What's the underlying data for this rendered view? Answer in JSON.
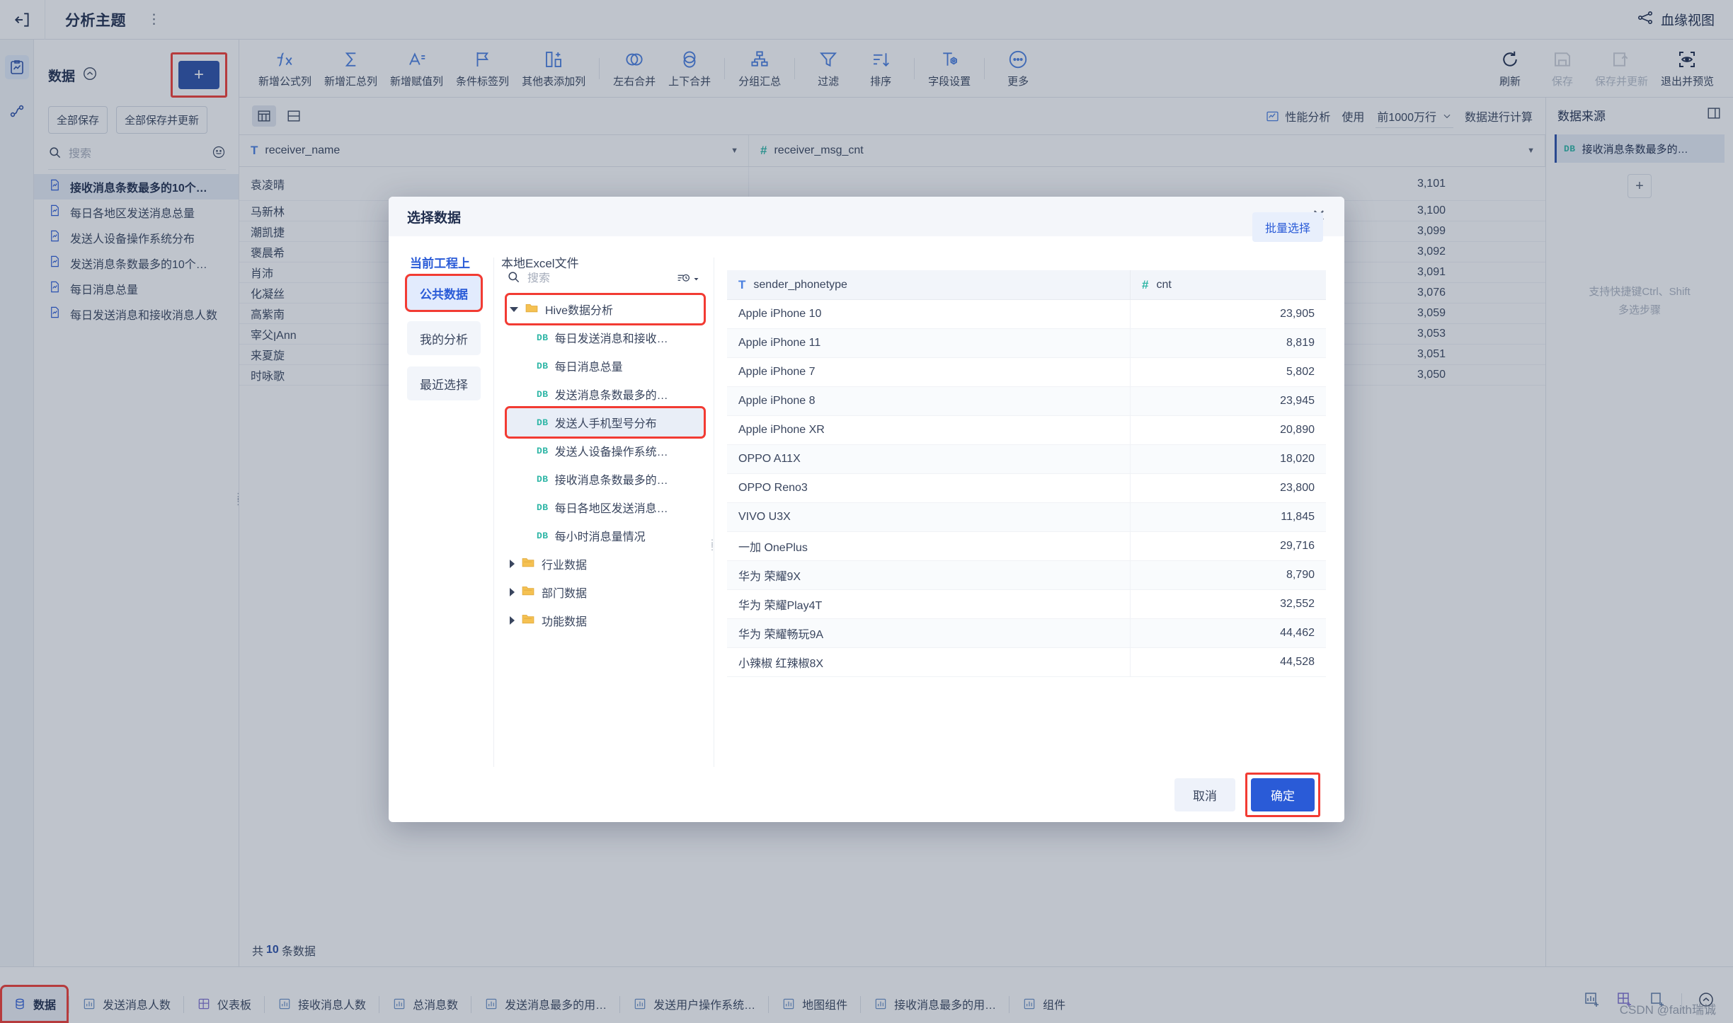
{
  "topbar": {
    "back_icon": "exit-left-icon",
    "title": "分析主题",
    "more_icon": "more-dots-icon",
    "lineage_label": "血缘视图",
    "lineage_icon": "lineage-icon"
  },
  "rail": {
    "items": [
      {
        "name": "analysis-board-icon",
        "label": ""
      },
      {
        "name": "data-flow-icon",
        "label": ""
      }
    ]
  },
  "left_panel": {
    "title": "数据",
    "collapse_icon": "collapse-chevron-icon",
    "add_label": "+",
    "save_all_label": "全部保存",
    "save_all_update_label": "全部保存并更新",
    "search_placeholder": "搜索",
    "search_value": "",
    "search_icon": "search-icon",
    "smile_icon": "smile-icon",
    "items": [
      {
        "label": "接收消息条数最多的10个…",
        "active": true
      },
      {
        "label": "每日各地区发送消息总量",
        "active": false
      },
      {
        "label": "发送人设备操作系统分布",
        "active": false
      },
      {
        "label": "发送消息条数最多的10个…",
        "active": false
      },
      {
        "label": "每日消息总量",
        "active": false
      },
      {
        "label": "每日发送消息和接收消息人数",
        "active": false
      }
    ]
  },
  "toolbar": {
    "tools": [
      {
        "label": "新增公式列",
        "icon": "fx-icon",
        "disabled": false
      },
      {
        "label": "新增汇总列",
        "icon": "sigma-icon",
        "disabled": false
      },
      {
        "label": "新增赋值列",
        "icon": "assign-column-icon",
        "disabled": false
      },
      {
        "label": "条件标签列",
        "icon": "flag-icon",
        "disabled": false
      },
      {
        "label": "其他表添加列",
        "icon": "add-column-icon",
        "disabled": false
      },
      {
        "label": "左右合并",
        "icon": "merge-horizontal-icon",
        "disabled": false
      },
      {
        "label": "上下合并",
        "icon": "merge-vertical-icon",
        "disabled": false
      },
      {
        "label": "分组汇总",
        "icon": "group-summary-icon",
        "disabled": false
      },
      {
        "label": "过滤",
        "icon": "filter-icon",
        "disabled": false
      },
      {
        "label": "排序",
        "icon": "sort-icon",
        "disabled": false
      },
      {
        "label": "字段设置",
        "icon": "field-settings-icon",
        "disabled": false
      },
      {
        "label": "更多",
        "icon": "more-circle-icon",
        "disabled": false
      }
    ],
    "right_tools": [
      {
        "label": "刷新",
        "icon": "refresh-icon",
        "disabled": false
      },
      {
        "label": "保存",
        "icon": "save-icon",
        "disabled": true
      },
      {
        "label": "保存并更新",
        "icon": "save-update-icon",
        "disabled": true
      },
      {
        "label": "退出并预览",
        "icon": "preview-icon",
        "disabled": false
      }
    ]
  },
  "main": {
    "view_table_icon": "table-view-icon",
    "view_card_icon": "card-view-icon",
    "perf_label": "性能分析",
    "perf_icon": "perf-icon",
    "use_label": "使用",
    "rows_value": "前1000万行",
    "rows_caret": "chevron-down-icon",
    "calc_label": "数据进行计算",
    "columns": [
      {
        "name": "receiver_name",
        "type_icon": "T"
      },
      {
        "name": "receiver_msg_cnt",
        "type_icon": "#"
      }
    ],
    "rows": [
      {
        "name": "袁凌晴",
        "value": "3,101"
      },
      {
        "name": "马新林",
        "value": "3,100"
      },
      {
        "name": "潮凯捷",
        "value": "3,099"
      },
      {
        "name": "褒晨希",
        "value": "3,092"
      },
      {
        "name": "肖沛",
        "value": "3,091"
      },
      {
        "name": "化凝丝",
        "value": "3,076"
      },
      {
        "name": "高紫南",
        "value": "3,059"
      },
      {
        "name": "宰父ןAnn",
        "value": "3,053"
      },
      {
        "name": "来夏旋",
        "value": "3,051"
      },
      {
        "name": "时咏歌",
        "value": "3,050"
      }
    ],
    "footer_prefix": "共",
    "footer_count": "10",
    "footer_suffix": "条数据"
  },
  "right_panel": {
    "title": "数据来源",
    "head_icon": "panel-collapse-icon",
    "items": [
      {
        "tag": "DB",
        "label": "接收消息条数最多的…"
      }
    ],
    "add_label": "+",
    "hint_line1": "支持快捷键Ctrl、Shift",
    "hint_line2": "多选步骤"
  },
  "modal": {
    "title": "选择数据",
    "close_icon": "close-icon",
    "tabs": [
      {
        "label": "当前工程上",
        "active": true
      },
      {
        "label": "本地Excel文件",
        "active": false
      }
    ],
    "batch_label": "批量选择",
    "side_items": [
      {
        "label": "公共数据",
        "active": true,
        "highlight": true
      },
      {
        "label": "我的分析",
        "active": false,
        "highlight": false
      },
      {
        "label": "最近选择",
        "active": false,
        "highlight": false
      }
    ],
    "search_placeholder": "搜索",
    "search_value": "",
    "search_icon": "search-icon",
    "history_icon": "history-filter-icon",
    "tree": [
      {
        "label": "Hive数据分析",
        "kind": "folder",
        "expanded": true,
        "indent": 0,
        "highlight": true
      },
      {
        "label": "每日发送消息和接收…",
        "kind": "db",
        "indent": 1,
        "selected": false
      },
      {
        "label": "每日消息总量",
        "kind": "db",
        "indent": 1,
        "selected": false
      },
      {
        "label": "发送消息条数最多的…",
        "kind": "db",
        "indent": 1,
        "selected": false
      },
      {
        "label": "发送人手机型号分布",
        "kind": "db",
        "indent": 1,
        "selected": true,
        "highlight": true
      },
      {
        "label": "发送人设备操作系统…",
        "kind": "db",
        "indent": 1,
        "selected": false
      },
      {
        "label": "接收消息条数最多的…",
        "kind": "db",
        "indent": 1,
        "selected": false
      },
      {
        "label": "每日各地区发送消息…",
        "kind": "db",
        "indent": 1,
        "selected": false
      },
      {
        "label": "每小时消息量情况",
        "kind": "db",
        "indent": 1,
        "selected": false
      },
      {
        "label": "行业数据",
        "kind": "folder",
        "expanded": false,
        "indent": 0
      },
      {
        "label": "部门数据",
        "kind": "folder",
        "expanded": false,
        "indent": 0
      },
      {
        "label": "功能数据",
        "kind": "folder",
        "expanded": false,
        "indent": 0
      }
    ],
    "table": {
      "columns": [
        {
          "name": "sender_phonetype",
          "type_icon": "T"
        },
        {
          "name": "cnt",
          "type_icon": "#"
        }
      ],
      "rows": [
        {
          "phone": "Apple iPhone 10",
          "cnt": "23,905"
        },
        {
          "phone": "Apple iPhone 11",
          "cnt": "8,819"
        },
        {
          "phone": "Apple iPhone 7",
          "cnt": "5,802"
        },
        {
          "phone": "Apple iPhone 8",
          "cnt": "23,945"
        },
        {
          "phone": "Apple iPhone XR",
          "cnt": "20,890"
        },
        {
          "phone": "OPPO A11X",
          "cnt": "18,020"
        },
        {
          "phone": "OPPO Reno3",
          "cnt": "23,800"
        },
        {
          "phone": "VIVO U3X",
          "cnt": "11,845"
        },
        {
          "phone": "一加 OnePlus",
          "cnt": "29,716"
        },
        {
          "phone": "华为 荣耀9X",
          "cnt": "8,790"
        },
        {
          "phone": "华为 荣耀Play4T",
          "cnt": "32,552"
        },
        {
          "phone": "华为 荣耀畅玩9A",
          "cnt": "44,462"
        },
        {
          "phone": "小辣椒 红辣椒8X",
          "cnt": "44,528"
        }
      ]
    },
    "cancel_label": "取消",
    "ok_label": "确定"
  },
  "bottom_tabs": [
    {
      "label": "数据",
      "icon": "database-icon",
      "active": true,
      "highlight": true
    },
    {
      "label": "发送消息人数",
      "icon": "chart-icon",
      "active": false
    },
    {
      "label": "仪表板",
      "icon": "dashboard-icon",
      "active": false
    },
    {
      "label": "接收消息人数",
      "icon": "chart-icon",
      "active": false
    },
    {
      "label": "总消息数",
      "icon": "chart-icon",
      "active": false
    },
    {
      "label": "发送消息最多的用…",
      "icon": "chart-icon",
      "active": false
    },
    {
      "label": "发送用户操作系统…",
      "icon": "chart-icon",
      "active": false
    },
    {
      "label": "地图组件",
      "icon": "chart-icon",
      "active": false
    },
    {
      "label": "接收消息最多的用…",
      "icon": "chart-icon",
      "active": false
    },
    {
      "label": "组件",
      "icon": "chart-icon",
      "active": false
    }
  ],
  "bottom_right_icons": [
    {
      "name": "add-chart-icon"
    },
    {
      "name": "add-dashboard-icon"
    },
    {
      "name": "add-page-icon"
    },
    {
      "name": "collapse-up-icon"
    }
  ],
  "watermark": "CSDN @faith瑞诚",
  "colors": {
    "accent": "#2a5bd7",
    "accent_dark": "#2a4fa8",
    "highlight": "#f23b33",
    "db_tag": "#2eb6a6",
    "folder": "#f5c152"
  }
}
